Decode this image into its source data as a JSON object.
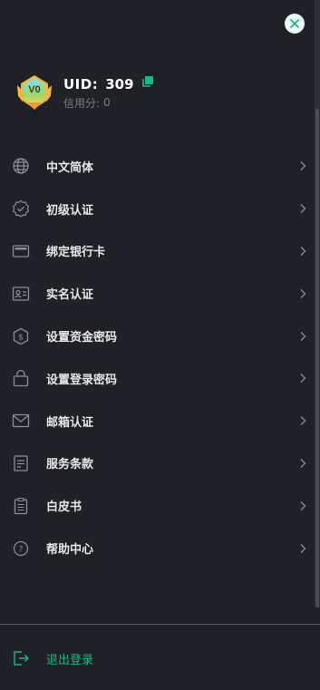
{
  "profile": {
    "level_badge": "V0",
    "uid_label": "UID:",
    "uid_value": "309",
    "credit_label": "信用分:",
    "credit_value": "0"
  },
  "menu": {
    "items": [
      {
        "label": "中文简体",
        "icon": "globe-icon"
      },
      {
        "label": "初级认证",
        "icon": "verified-badge-icon"
      },
      {
        "label": "绑定银行卡",
        "icon": "wallet-card-icon"
      },
      {
        "label": "实名认证",
        "icon": "id-card-icon"
      },
      {
        "label": "设置资金密码",
        "icon": "dollar-shield-icon"
      },
      {
        "label": "设置登录密码",
        "icon": "lock-icon"
      },
      {
        "label": "邮箱认证",
        "icon": "mail-icon"
      },
      {
        "label": "服务条款",
        "icon": "document-icon"
      },
      {
        "label": "白皮书",
        "icon": "clipboard-icon"
      },
      {
        "label": "帮助中心",
        "icon": "help-icon"
      }
    ]
  },
  "logout": {
    "label": "退出登录",
    "icon": "logout-icon"
  },
  "colors": {
    "background": "#1f2127",
    "accent": "#1fb585",
    "text": "#e6e7ea",
    "muted": "#7a7e86",
    "icon": "#8a8e96"
  }
}
